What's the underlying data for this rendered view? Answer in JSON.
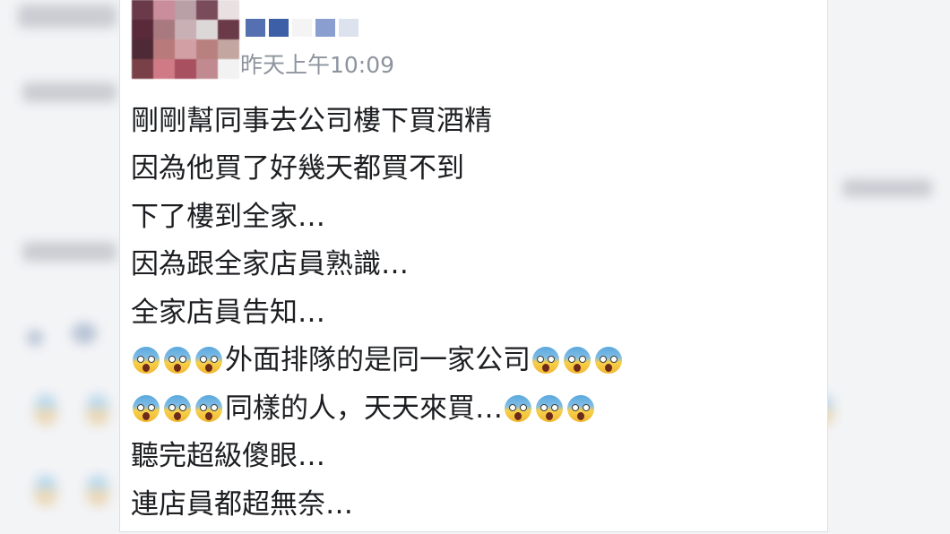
{
  "post": {
    "timestamp": "昨天上午10:09",
    "lines": [
      "剛剛幫同事去公司樓下買酒精",
      "因為他買了好幾天都買不到",
      "下了樓到全家…",
      "因為跟全家店員熟識…",
      "全家店員告知…",
      "外面排隊的是同一家公司",
      "同樣的人，天天來買…",
      "聽完超級傻眼…",
      "連店員都超無奈…"
    ],
    "emoji_name": "face-screaming-in-fear-icon"
  },
  "avatar_colors": [
    "#6b3a4a",
    "#c98d9b",
    "#b9a0a6",
    "#7a4b5a",
    "#e9e0e2",
    "#5a2a3a",
    "#a87a7f",
    "#c9b0b4",
    "#dcd8d8",
    "#6a3a48",
    "#4e2a36",
    "#b87a7a",
    "#d2a0a4",
    "#b98080",
    "#c4a6a0",
    "#7a4048",
    "#d07a86",
    "#a85060",
    "#c08a90",
    "#f2f2f2"
  ],
  "author_name_colors": [
    "#5470b0",
    "#3d5fa8",
    "#f4f4f4",
    "#8a9fd0",
    "#dce2ee"
  ]
}
